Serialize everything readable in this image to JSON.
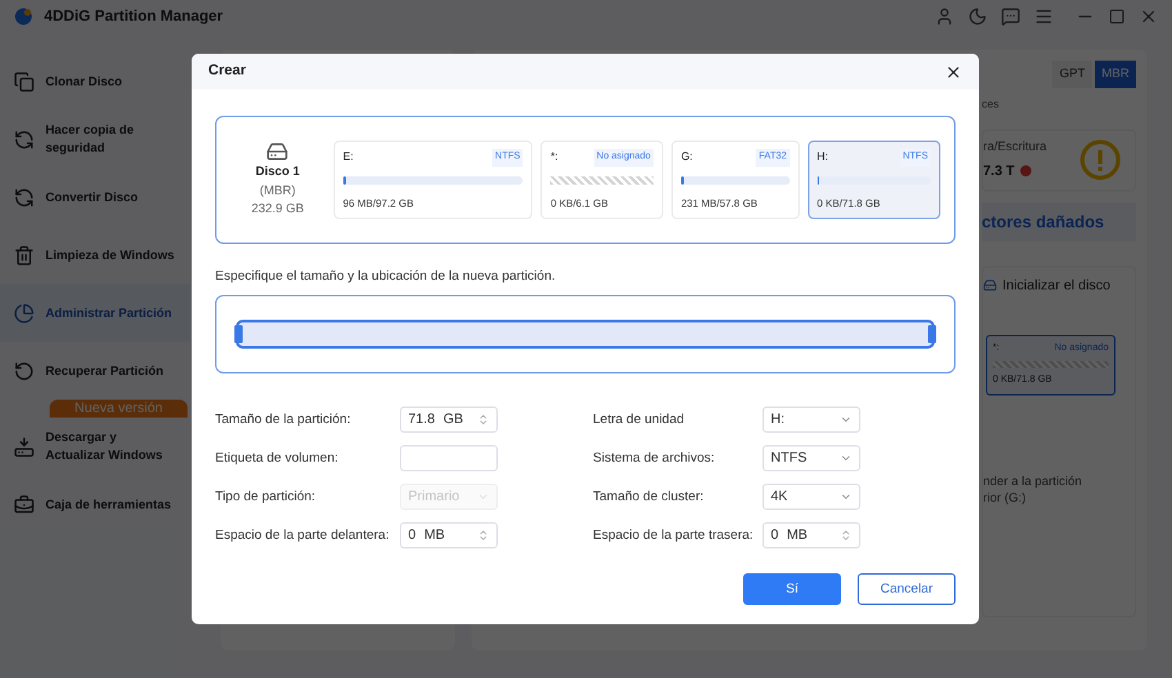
{
  "app": {
    "title": "4DDiG Partition Manager"
  },
  "sidebar": {
    "items": [
      {
        "label": "Clonar Disco",
        "selected": false
      },
      {
        "label": "Hacer copia de seguridad",
        "selected": false
      },
      {
        "label": "Convertir Disco",
        "selected": false
      },
      {
        "label": "Limpieza de Windows",
        "selected": false
      },
      {
        "label": "Administrar Partición",
        "selected": true
      },
      {
        "label": "Recuperar Partición",
        "selected": false
      },
      {
        "label": "Descargar y Actualizar Windows",
        "selected": false,
        "badge": "Nueva versión"
      },
      {
        "label": "Caja de herramientas",
        "selected": false
      }
    ]
  },
  "background": {
    "styles": [
      {
        "label": "GPT",
        "selected": false
      },
      {
        "label": "MBR",
        "selected": true
      }
    ],
    "partial_note": "ces",
    "health_label": "ra/Escritura",
    "health_value": "7.3 T",
    "sectors_link": "ctores dañados",
    "init_label": "Inicializar el disco",
    "card": {
      "letter": "*:",
      "type": "No asignado",
      "size": "0 KB/71.8 GB"
    },
    "extend_text_1": "nder a la partición",
    "extend_text_2": "rior (G:)"
  },
  "dialog": {
    "title": "Crear",
    "disk": {
      "name": "Disco 1",
      "style": "(MBR)",
      "size": "232.9 GB"
    },
    "partitions": [
      {
        "letter": "E:",
        "fs": "NTFS",
        "kind": "used",
        "level": 0.02,
        "size": "96 MB/97.2 GB",
        "selected": false
      },
      {
        "letter": "*:",
        "fs": "No asignado",
        "kind": "unallocated",
        "size": "0 KB/6.1 GB",
        "selected": false
      },
      {
        "letter": "G:",
        "fs": "FAT32",
        "kind": "used",
        "level": 0.02,
        "size": "231 MB/57.8 GB",
        "selected": false
      },
      {
        "letter": "H:",
        "fs": "NTFS",
        "kind": "used",
        "level": 0.02,
        "size": "0 KB/71.8 GB",
        "selected": true
      }
    ],
    "instruction": "Especifique el tamaño y la ubicación de la nueva partición.",
    "fields_left": [
      {
        "label": "Tamaño de la partición:",
        "kind": "spinner",
        "value": "71.8",
        "unit": "GB",
        "disabled": false
      },
      {
        "label": "Etiqueta de volumen:",
        "kind": "text",
        "disabled": false
      },
      {
        "label": "Tipo de partición:",
        "kind": "select",
        "value": "Primario",
        "disabled": true
      },
      {
        "label": "Espacio de la parte delantera:",
        "kind": "spinner",
        "value": "0",
        "unit": "MB",
        "disabled": false
      }
    ],
    "fields_right": [
      {
        "label": "Letra de unidad",
        "kind": "select",
        "value": "H:",
        "disabled": false
      },
      {
        "label": "Sistema de archivos:",
        "kind": "select",
        "value": "NTFS",
        "disabled": false
      },
      {
        "label": "Tamaño de cluster:",
        "kind": "select",
        "value": "4K",
        "disabled": false
      },
      {
        "label": "Espacio de la parte trasera:",
        "kind": "spinner",
        "value": "0",
        "unit": "MB",
        "disabled": false
      }
    ],
    "buttons": [
      {
        "label": "Sí",
        "kind": "primary"
      },
      {
        "label": "Cancelar",
        "kind": "secondary"
      }
    ]
  }
}
